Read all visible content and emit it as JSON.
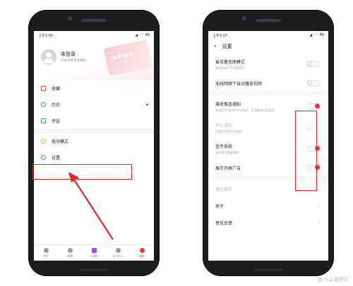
{
  "left_phone": {
    "status": {
      "time": "上午1:05",
      "battery": "48"
    },
    "profile": {
      "title": "未登录",
      "subtitle": "登录发现更多精彩",
      "deco_text": "NEWS"
    },
    "menu": [
      {
        "label": "收藏",
        "icon": "star-icon"
      },
      {
        "label": "历史",
        "icon": "clock-icon",
        "has_badge": true
      },
      {
        "label": "评论",
        "icon": "comment-icon"
      },
      {
        "label": "夜间模式",
        "icon": "moon-icon"
      },
      {
        "label": "设置",
        "icon": "gear-icon"
      }
    ],
    "tabs": [
      {
        "label": "首页",
        "icon": "home-icon"
      },
      {
        "label": "视频",
        "icon": "play-icon"
      },
      {
        "label": "小视频",
        "icon": "short-video-icon"
      },
      {
        "label": "金币中心",
        "icon": "coin-icon"
      },
      {
        "label": "我的",
        "icon": "profile-icon",
        "active": true
      }
    ]
  },
  "right_phone": {
    "status": {
      "time": "上午1:07",
      "battery": "48"
    },
    "nav": {
      "back": "‹",
      "title": "设置"
    },
    "settings": [
      {
        "title": "省流量无图模式",
        "subtitle": "移动网络下不加载图片",
        "toggle": "off"
      },
      {
        "title": "无线网络下自动播放视频",
        "subtitle": "",
        "toggle": "off"
      },
      {
        "title": "接收推送通知",
        "subtitle": "关闭后不再接收任何通知，包括精选内容推送",
        "toggle": "on"
      },
      {
        "title": "评论通知",
        "subtitle": "回复后开启评论通知",
        "toggle": "dim",
        "disabled": true
      },
      {
        "title": "金币系统",
        "subtitle": "阅读资讯就能赚钱",
        "toggle": "on"
      },
      {
        "title": "展示开屏广告",
        "subtitle": "",
        "toggle": "on"
      }
    ],
    "clear_cache": "清空缓存",
    "links": [
      {
        "label": "关于"
      },
      {
        "label": "意见反馈"
      }
    ]
  },
  "watermark": "值·什么值得买",
  "colors": {
    "accent": "#e53838",
    "highlight_box": "#d72b2b",
    "phone_body": "#1b1c1e"
  }
}
